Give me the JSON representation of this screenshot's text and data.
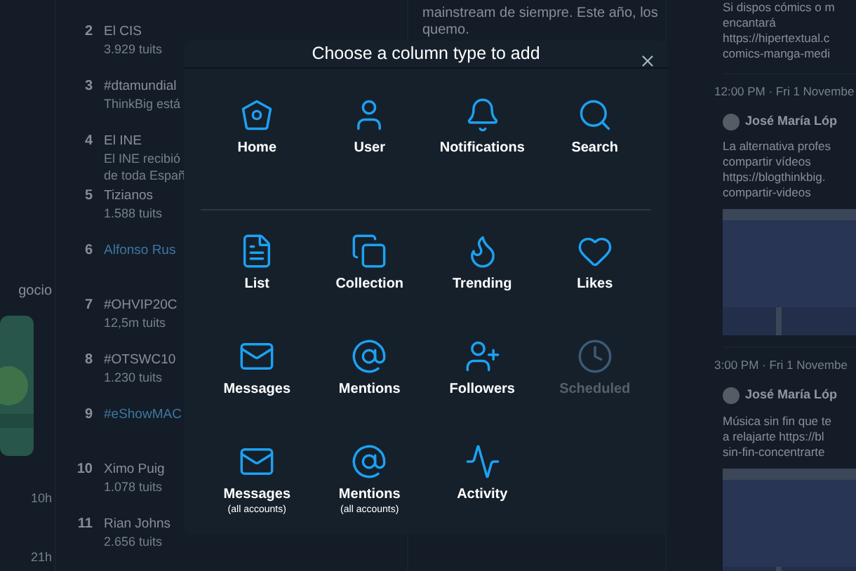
{
  "background": {
    "left_column": {
      "texts": [
        "gocio",
        "10h",
        "21h"
      ]
    },
    "trends": [
      {
        "rank": "2",
        "name": "El CIS",
        "details": [
          "3.929 tuits"
        ],
        "link": false
      },
      {
        "rank": "3",
        "name": "#dtamundial",
        "details": [
          "ThinkBig está"
        ],
        "link": false
      },
      {
        "rank": "4",
        "name": "El INE",
        "details": [
          "El INE recibió",
          "de toda Españ"
        ],
        "link": false
      },
      {
        "rank": "5",
        "name": "Tizianos",
        "details": [
          "1.588 tuits"
        ],
        "link": false
      },
      {
        "rank": "6",
        "name": "Alfonso Rus",
        "link": true
      },
      {
        "rank": "7",
        "name": "#OHVIP20C",
        "details": [
          "12,5m tuits"
        ],
        "link": false
      },
      {
        "rank": "8",
        "name": "#OTSWC10",
        "details": [
          "1.230 tuits"
        ],
        "link": false
      },
      {
        "rank": "9",
        "name": "#eShowMAC",
        "link": true
      },
      {
        "rank": "10",
        "name": "Ximo Puig",
        "details": [
          "1.078 tuits"
        ],
        "link": false
      },
      {
        "rank": "11",
        "name": "Rian Johns",
        "details": [
          "2.656 tuits"
        ],
        "link": false
      }
    ],
    "middle_column": {
      "lines": [
        "mainstream de siempre. Este año, los",
        "quemo."
      ]
    },
    "right_column": {
      "intro": [
        "Si dispos cómics o m",
        "encantará",
        "https://hipertextual.c",
        "comics-manga-medi"
      ],
      "tweets": [
        {
          "time": "12:00 PM · Fri 1 Novembe",
          "author": "José María Lóp",
          "lines": [
            "La alternativa profes",
            "compartir vídeos",
            "https://blogthinkbig.",
            "compartir-videos"
          ]
        },
        {
          "time": "3:00 PM · Fri 1 Novembe",
          "author": "José María Lóp",
          "lines": [
            "Música sin fin que te",
            "a relajarte https://bl",
            "sin-fin-concentrarte"
          ]
        }
      ]
    }
  },
  "modal": {
    "title": "Choose a column type to add",
    "groups": [
      [
        {
          "label": "Home",
          "disabled": false
        },
        {
          "label": "User",
          "disabled": false
        },
        {
          "label": "Notifications",
          "disabled": false
        },
        {
          "label": "Search",
          "disabled": false
        }
      ],
      [
        {
          "label": "List",
          "disabled": false
        },
        {
          "label": "Collection",
          "disabled": false
        },
        {
          "label": "Trending",
          "disabled": false
        },
        {
          "label": "Likes",
          "disabled": false
        },
        {
          "label": "Messages",
          "disabled": false
        },
        {
          "label": "Mentions",
          "disabled": false
        },
        {
          "label": "Followers",
          "disabled": false
        },
        {
          "label": "Scheduled",
          "disabled": true
        },
        {
          "label": "Messages",
          "sublabel": "(all accounts)",
          "disabled": false
        },
        {
          "label": "Mentions",
          "sublabel": "(all accounts)",
          "disabled": false
        },
        {
          "label": "Activity",
          "disabled": false
        }
      ]
    ]
  }
}
